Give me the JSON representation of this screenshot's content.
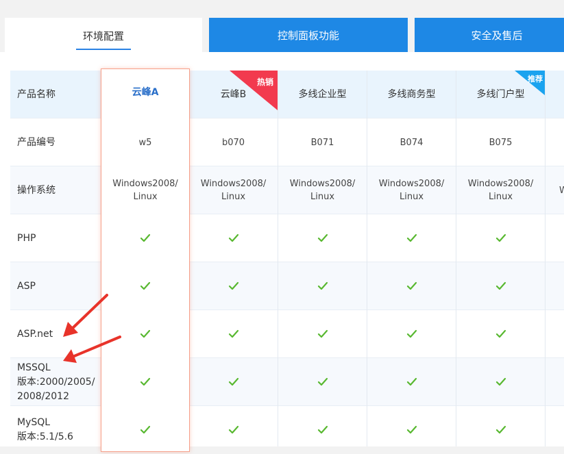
{
  "tabs": [
    {
      "label": "环境配置",
      "active": true
    },
    {
      "label": "控制面板功能",
      "active": false
    },
    {
      "label": "安全及售后",
      "active": false
    }
  ],
  "row_labels": [
    "产品名称",
    "产品编号",
    "操作系统",
    "PHP",
    "ASP",
    "ASP.net",
    "MSSQL\n版本:2000/2005/\n2008/2012",
    "MySQL\n版本:5.1/5.6"
  ],
  "products": [
    {
      "name": "云峰A",
      "code": "w5",
      "os": "Windows2008/\nLinux"
    },
    {
      "name": "云峰B",
      "code": "b070",
      "os": "Windows2008/\nLinux",
      "badge": "热销"
    },
    {
      "name": "多线企业型",
      "code": "B071",
      "os": "Windows2008/\nLinux"
    },
    {
      "name": "多线商务型",
      "code": "B074",
      "os": "Windows2008/\nLinux"
    },
    {
      "name": "多线门户型",
      "code": "B075",
      "os": "Windows2008/\nLinux",
      "badge": "推荐"
    },
    {
      "name": "",
      "code": "",
      "os": "W"
    }
  ],
  "colors": {
    "tab_blue": "#1e88e5",
    "check": "#58b830",
    "hot": "#f23a4e",
    "recommend": "#1aa3ef",
    "arrow": "#e8332a"
  }
}
